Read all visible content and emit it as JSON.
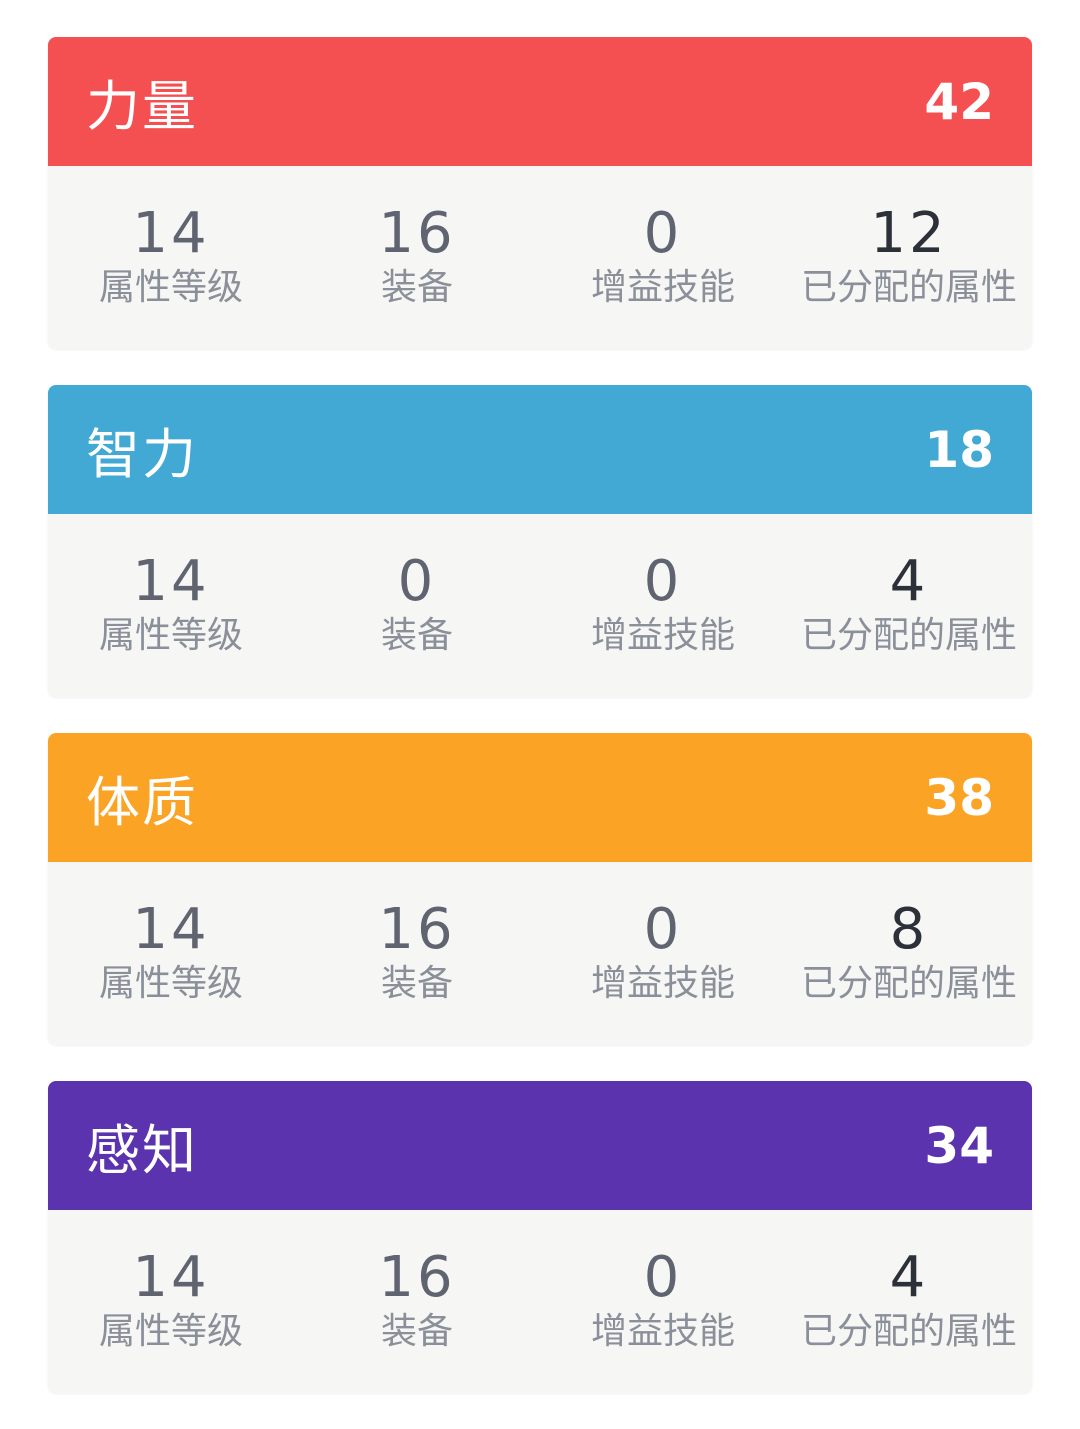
{
  "labels": {
    "level": "属性等级",
    "equipment": "装备",
    "buff": "增益技能",
    "allocated": "已分配的属性"
  },
  "attributes": [
    {
      "name": "力量",
      "total": "42",
      "color": "#f45051",
      "level": "14",
      "equipment": "16",
      "buff": "0",
      "allocated": "12"
    },
    {
      "name": "智力",
      "total": "18",
      "color": "#42a8d4",
      "level": "14",
      "equipment": "0",
      "buff": "0",
      "allocated": "4"
    },
    {
      "name": "体质",
      "total": "38",
      "color": "#fba324",
      "level": "14",
      "equipment": "16",
      "buff": "0",
      "allocated": "8"
    },
    {
      "name": "感知",
      "total": "34",
      "color": "#5c33ae",
      "level": "14",
      "equipment": "16",
      "buff": "0",
      "allocated": "4"
    }
  ]
}
